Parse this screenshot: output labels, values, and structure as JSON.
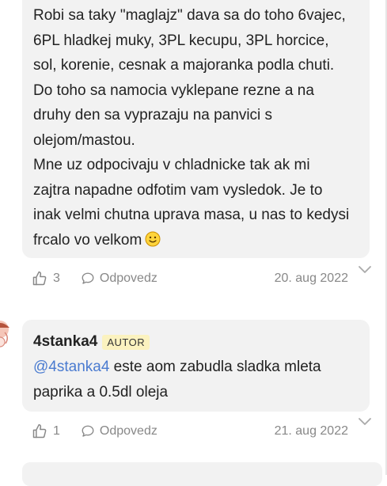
{
  "comment_1": {
    "lines": [
      "Robi sa taky \"maglajz\" dava sa do toho 6vajec,",
      "6PL hladkej muky, 3PL kecupu, 3PL horcice,",
      "sol, korenie, cesnak a majoranka podla chuti.",
      "Do toho sa namocia vyklepane rezne a na",
      "druhy den sa vyprazaju na panvici s",
      "olejom/mastou.",
      "Mne uz odpocivaju v chladnicke tak ak mi",
      "zajtra napadne odfotim vam vysledok. Je to",
      "inak velmi chutna uprava masa, u nas to kedysi",
      "frcalo vo velkom"
    ],
    "emoji_icon": "smiling-face-emoji",
    "likes": "3",
    "reply_label": "Odpovedz",
    "date": "20. aug 2022"
  },
  "comment_2": {
    "username": "4stanka4",
    "badge": "AUTOR",
    "mention": "@4stanka4",
    "line_1_rest": " este aom zabudla sladka mleta",
    "line_2": "paprika a 0.5dl oleja",
    "likes": "1",
    "reply_label": "Odpovedz",
    "date": "21. aug 2022"
  },
  "colors": {
    "bubble": "#f2f2f2",
    "mention": "#4a7bd0",
    "badge_bg": "#fbf2bf",
    "muted": "#888888"
  }
}
